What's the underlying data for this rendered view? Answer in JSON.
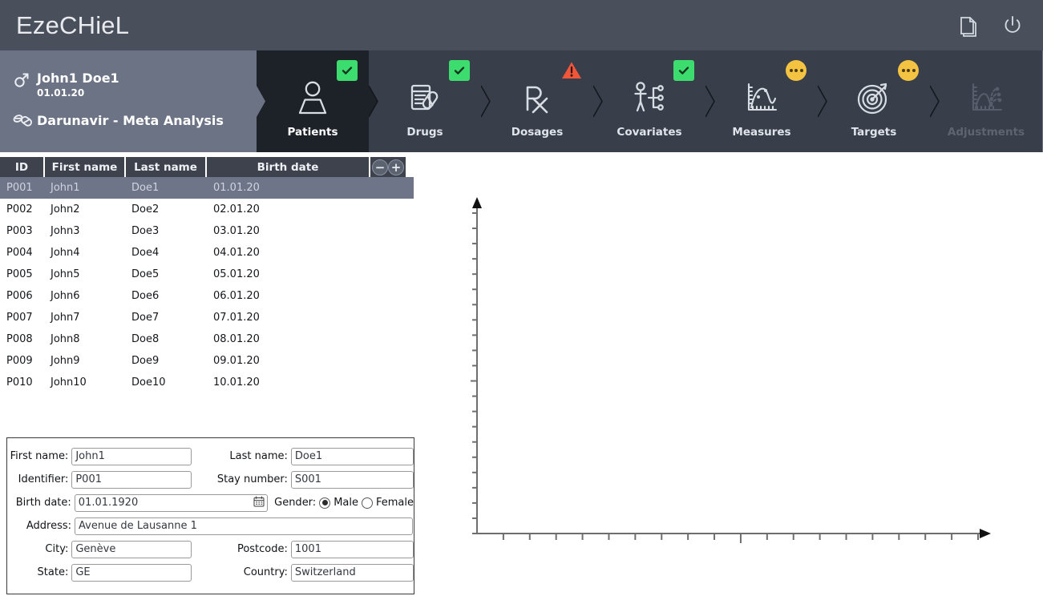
{
  "titlebar": {
    "app_title": "EzeCHieL",
    "actions": [
      {
        "name": "copy-icon",
        "label": "Copy"
      },
      {
        "name": "power-icon",
        "label": "Power"
      }
    ]
  },
  "patient_band": {
    "gender_icon": "mars-icon",
    "patient_name": "John1 Doe1",
    "birth_date": "01.01.20",
    "drug_icon": "pill-icon",
    "drug_label": "Darunavir - Meta Analysis"
  },
  "tabs": [
    {
      "label": "Patients",
      "icon": "person-icon",
      "status": "ok",
      "active": true,
      "disabled": false
    },
    {
      "label": "Drugs",
      "icon": "pills-icon",
      "status": "ok",
      "active": false,
      "disabled": false
    },
    {
      "label": "Dosages",
      "icon": "rx-icon",
      "status": "warning",
      "active": false,
      "disabled": false
    },
    {
      "label": "Covariates",
      "icon": "covariate-icon",
      "status": "ok",
      "active": false,
      "disabled": false
    },
    {
      "label": "Measures",
      "icon": "measures-icon",
      "status": "pending",
      "active": false,
      "disabled": false
    },
    {
      "label": "Targets",
      "icon": "target-icon",
      "status": "pending",
      "active": false,
      "disabled": false
    },
    {
      "label": "Adjustments",
      "icon": "adjustment-icon",
      "status": "none",
      "active": false,
      "disabled": true
    }
  ],
  "patient_table": {
    "columns": [
      "ID",
      "First name",
      "Last name",
      "Birth date"
    ],
    "remove_button": "−",
    "add_button": "+",
    "rows": [
      {
        "id": "P001",
        "first": "John1",
        "last": "Doe1",
        "birth": "01.01.20",
        "selected": true
      },
      {
        "id": "P002",
        "first": "John2",
        "last": "Doe2",
        "birth": "02.01.20",
        "selected": false
      },
      {
        "id": "P003",
        "first": "John3",
        "last": "Doe3",
        "birth": "03.01.20",
        "selected": false
      },
      {
        "id": "P004",
        "first": "John4",
        "last": "Doe4",
        "birth": "04.01.20",
        "selected": false
      },
      {
        "id": "P005",
        "first": "John5",
        "last": "Doe5",
        "birth": "05.01.20",
        "selected": false
      },
      {
        "id": "P006",
        "first": "John6",
        "last": "Doe6",
        "birth": "06.01.20",
        "selected": false
      },
      {
        "id": "P007",
        "first": "John7",
        "last": "Doe7",
        "birth": "07.01.20",
        "selected": false
      },
      {
        "id": "P008",
        "first": "John8",
        "last": "Doe8",
        "birth": "08.01.20",
        "selected": false
      },
      {
        "id": "P009",
        "first": "John9",
        "last": "Doe9",
        "birth": "09.01.20",
        "selected": false
      },
      {
        "id": "P010",
        "first": "John10",
        "last": "Doe10",
        "birth": "10.01.20",
        "selected": false
      }
    ]
  },
  "form": {
    "first_name": {
      "label": "First name:",
      "value": "John1"
    },
    "last_name": {
      "label": "Last name:",
      "value": "Doe1"
    },
    "identifier": {
      "label": "Identifier:",
      "value": "P001"
    },
    "stay_number": {
      "label": "Stay number:",
      "value": "S001"
    },
    "birth_date": {
      "label": "Birth date:",
      "value": "01.01.1920"
    },
    "gender": {
      "label": "Gender:",
      "options": [
        "Male",
        "Female"
      ],
      "selected": "Male"
    },
    "address": {
      "label": "Address:",
      "value": "Avenue de Lausanne 1"
    },
    "city": {
      "label": "City:",
      "value": "Genève"
    },
    "postcode": {
      "label": "Postcode:",
      "value": "1001"
    },
    "state": {
      "label": "State:",
      "value": "GE"
    },
    "country": {
      "label": "Country:",
      "value": "Switzerland"
    }
  },
  "chart_data": {
    "type": "line",
    "title": "",
    "xlabel": "",
    "ylabel": "",
    "series": [],
    "x": [],
    "values": [],
    "grid": false,
    "legend": "none",
    "y_major_ticks": 1,
    "y_minor_ticks": 21,
    "x_major_ticks": 1,
    "x_minor_ticks": 19,
    "empty": true
  },
  "colors": {
    "titlebar": "#4a4f5c",
    "patient_band": "#6b7385",
    "tab_bg": "#393f4a",
    "tab_active_bg": "#1c2228",
    "badge_ok": "#3ddc6e",
    "badge_warn": "#f0563a",
    "badge_pending": "#f5c342",
    "table_header": "#3d424d",
    "row_selected": "#6e7588"
  }
}
